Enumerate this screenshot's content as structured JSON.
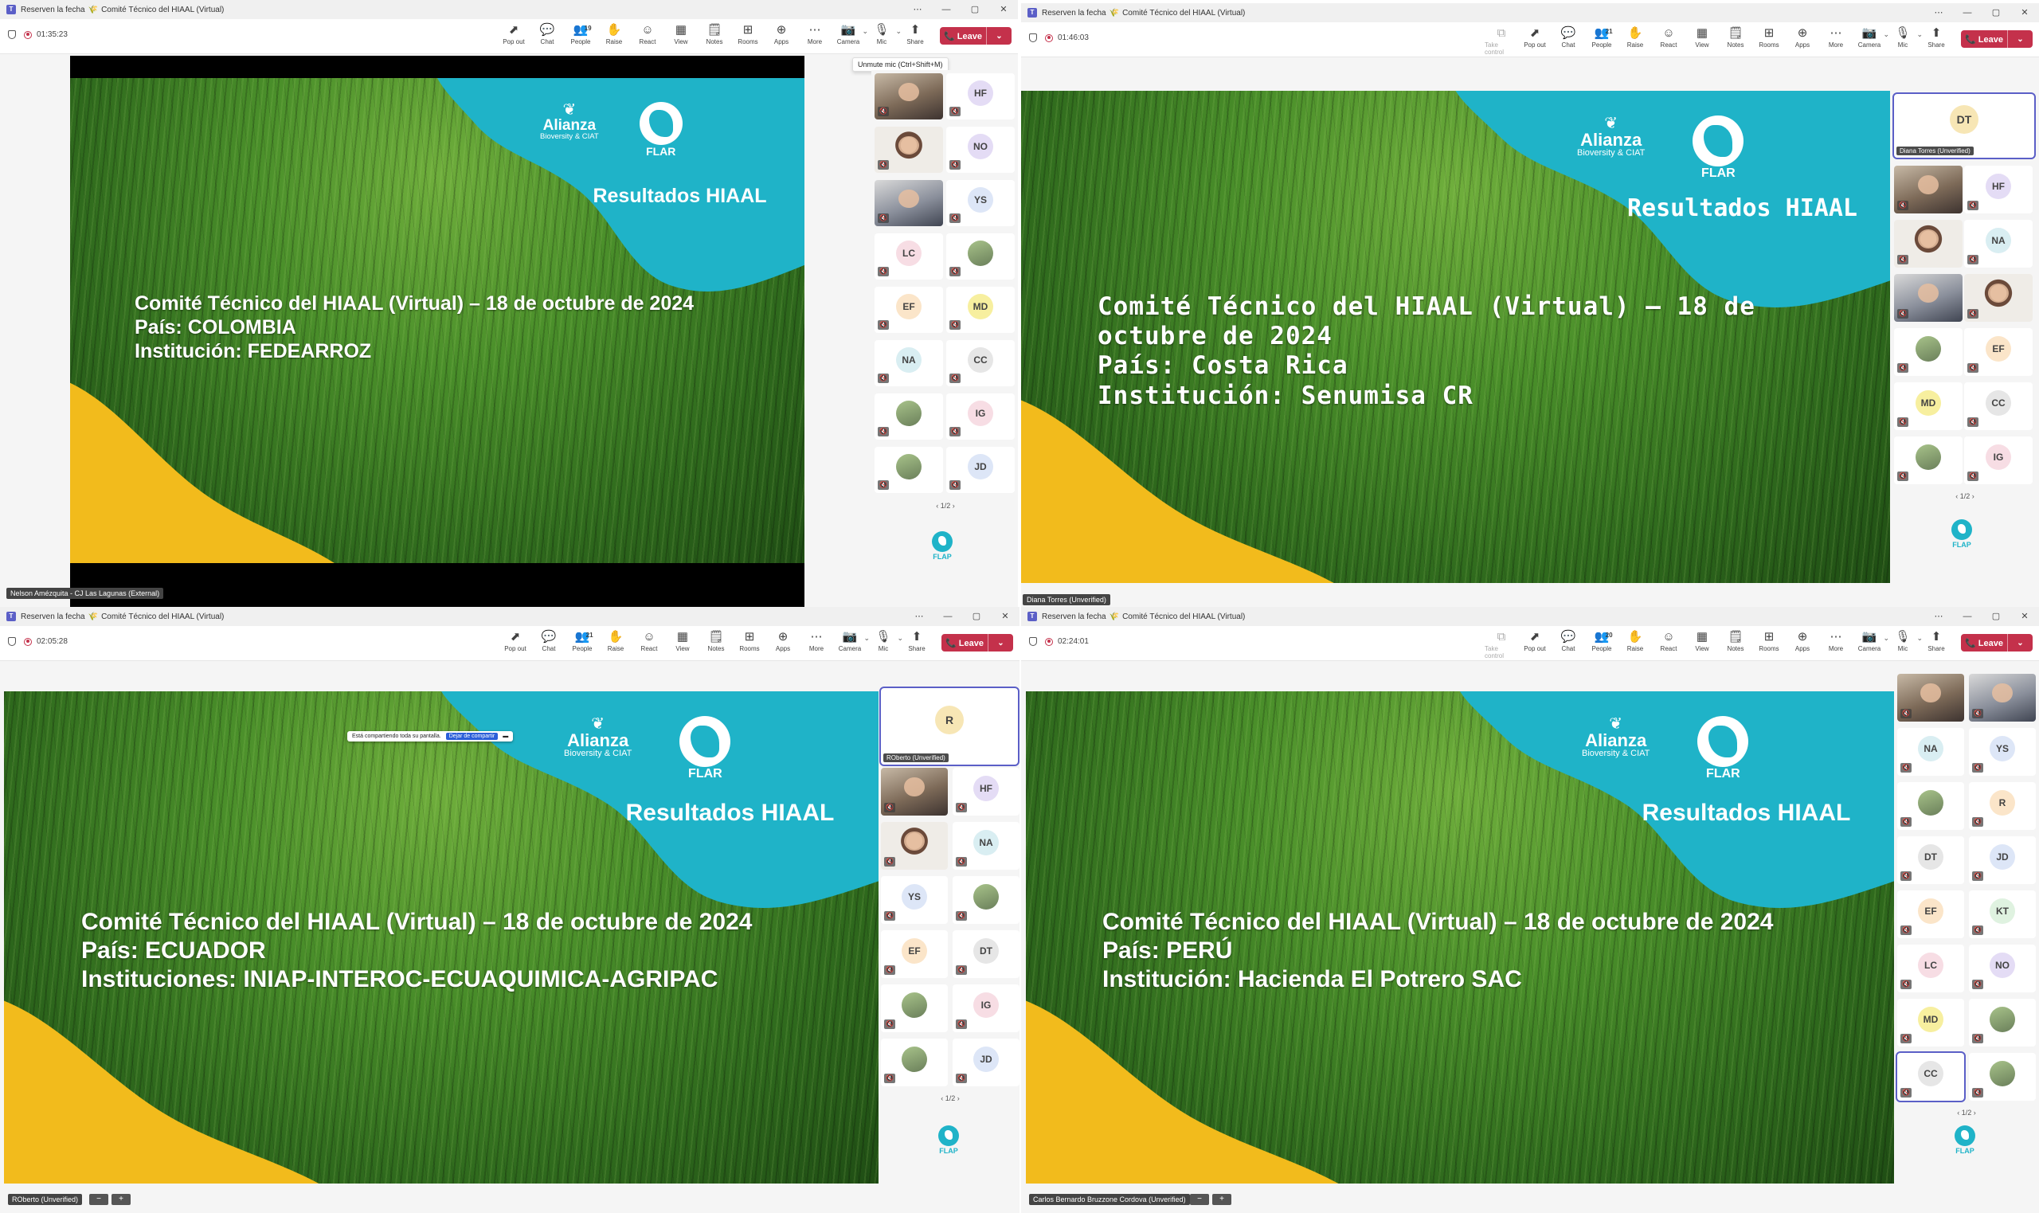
{
  "window_title": {
    "meeting": "Reserven la fecha",
    "sprout": "🌾",
    "name": "Comité Técnico del HIAAL (Virtual)"
  },
  "window_controls": [
    "⋯",
    "—",
    "▢",
    "✕"
  ],
  "toolbar_labels": {
    "take_control": "Take control",
    "pop_out": "Pop out",
    "chat": "Chat",
    "people": "People",
    "raise": "Raise",
    "react": "React",
    "view": "View",
    "notes": "Notes",
    "rooms": "Rooms",
    "apps": "Apps",
    "more": "More",
    "camera": "Camera",
    "mic": "Mic",
    "share": "Share",
    "leave": "Leave"
  },
  "slide_common": {
    "alianza_name": "Alianza",
    "alianza_sub": "Bioversity & CIAT",
    "flar": "FLAR",
    "results": "Resultados HIAAL",
    "event": "Comité Técnico del HIAAL (Virtual) – 18 de octubre de 2024"
  },
  "tooltip": "Unmute mic (Ctrl+Shift+M)",
  "share_notice": {
    "text": "Está compartiendo toda su pantalla.",
    "stop": "Dejar de compartir"
  },
  "flap_logo": "FLAP",
  "colors": {
    "teal": "#1fb3c8",
    "yellow": "#f2bb1c",
    "leave": "#c4314b",
    "accent": "#5b5fc7"
  },
  "panes": [
    {
      "timer": "01:35:23",
      "people_count": "19",
      "country": "País: COLOMBIA",
      "institution": "Institución: FEDEARROZ",
      "pager": "1/2",
      "presenter": "Nelson Amézquita - CJ Las Lagunas (External)",
      "tiles": [
        {
          "type": "video"
        },
        {
          "initials": "HF",
          "color": "#e4dcf5"
        },
        {
          "type": "video"
        },
        {
          "initials": "NO",
          "color": "#e4dcf5"
        },
        {
          "type": "video"
        },
        {
          "initials": "YS",
          "color": "#dde6f7"
        },
        {
          "initials": "LC",
          "color": "#f7dde4"
        },
        {
          "type": "photo"
        },
        {
          "initials": "EF",
          "color": "#fbe5c9"
        },
        {
          "initials": "MD",
          "color": "#f7ef9f"
        },
        {
          "initials": "NA",
          "color": "#d9eef2"
        },
        {
          "initials": "CC",
          "color": "#e6e6e6"
        },
        {
          "type": "photo"
        },
        {
          "initials": "IG",
          "color": "#f7dde4"
        },
        {
          "type": "photo"
        },
        {
          "initials": "JD",
          "color": "#dde6f7"
        }
      ]
    },
    {
      "timer": "01:46:03",
      "people_count": "21",
      "country": "País: Costa Rica",
      "institution": "Institución: Senumisa CR",
      "pager": "1/2",
      "presenter": "Diana Torres (Unverified)",
      "top_tile": {
        "initials": "DT",
        "label": "Diana Torres (Unverified)"
      },
      "tiles": [
        {
          "type": "video"
        },
        {
          "initials": "HF",
          "color": "#e4dcf5"
        },
        {
          "type": "video"
        },
        {
          "initials": "NA",
          "color": "#d9eef2"
        },
        {
          "type": "video"
        },
        {
          "type": "video"
        },
        {
          "type": "photo"
        },
        {
          "initials": "EF",
          "color": "#fbe5c9"
        },
        {
          "initials": "MD",
          "color": "#f7ef9f"
        },
        {
          "initials": "CC",
          "color": "#e6e6e6"
        },
        {
          "type": "photo"
        },
        {
          "initials": "IG",
          "color": "#f7dde4"
        }
      ]
    },
    {
      "timer": "02:05:28",
      "people_count": "21",
      "country": "País: ECUADOR",
      "institution": "Instituciones: INIAP-INTEROC-ECUAQUIMICA-AGRIPAC",
      "pager": "1/2",
      "presenter": "ROberto (Unverified)",
      "top_tile": {
        "initials": "R",
        "label": "ROberto (Unverified)"
      },
      "tiles": [
        {
          "type": "video"
        },
        {
          "initials": "HF",
          "color": "#e4dcf5"
        },
        {
          "type": "video"
        },
        {
          "initials": "NA",
          "color": "#d9eef2"
        },
        {
          "initials": "YS",
          "color": "#dde6f7"
        },
        {
          "type": "photo"
        },
        {
          "initials": "EF",
          "color": "#fbe5c9"
        },
        {
          "initials": "DT",
          "color": "#e6e6e6"
        },
        {
          "type": "photo"
        },
        {
          "initials": "IG",
          "color": "#f7dde4"
        },
        {
          "type": "photo"
        },
        {
          "initials": "JD",
          "color": "#dde6f7"
        }
      ]
    },
    {
      "timer": "02:24:01",
      "people_count": "20",
      "country": "País: PERÚ",
      "institution": "Institución: Hacienda El Potrero SAC",
      "pager": "1/2",
      "presenter": "Carlos Bernardo Bruzzone Cordova (Unverified)",
      "tiles": [
        {
          "type": "video"
        },
        {
          "type": "video"
        },
        {
          "initials": "NA",
          "color": "#d9eef2"
        },
        {
          "initials": "YS",
          "color": "#dde6f7"
        },
        {
          "type": "photo"
        },
        {
          "initials": "R",
          "color": "#fbe5c9"
        },
        {
          "initials": "DT",
          "color": "#e6e6e6"
        },
        {
          "initials": "JD",
          "color": "#dde6f7"
        },
        {
          "initials": "EF",
          "color": "#fbe5c9"
        },
        {
          "initials": "KT",
          "color": "#dff2e0"
        },
        {
          "initials": "LC",
          "color": "#f7dde4"
        },
        {
          "initials": "NO",
          "color": "#e4dcf5"
        },
        {
          "initials": "MD",
          "color": "#f7ef9f"
        },
        {
          "type": "photo"
        },
        {
          "initials": "CC",
          "color": "#e6e6e6"
        },
        {
          "type": "photo"
        }
      ]
    }
  ]
}
